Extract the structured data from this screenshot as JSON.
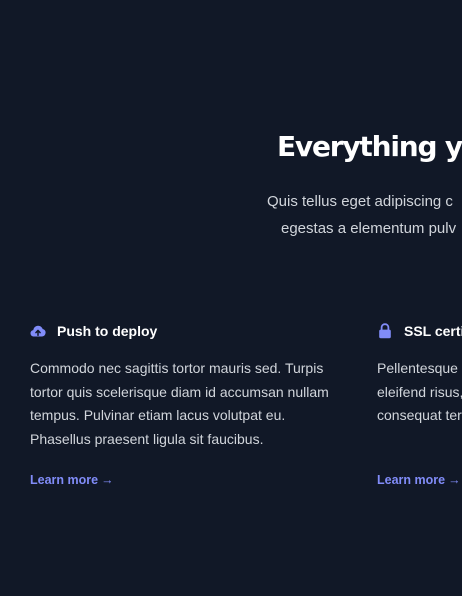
{
  "hero": {
    "title": "Everything you",
    "subtitle_line1": "Quis tellus eget adipiscing c",
    "subtitle_line2": "egestas a elementum pulv"
  },
  "features": [
    {
      "title": "Push to deploy",
      "icon": "cloud-upload-icon",
      "desc_lines": [
        "Commodo nec sagittis tortor mauris sed. Turpis",
        "tortor quis scelerisque diam id accumsan nullam",
        "tempus. Pulvinar etiam lacus volutpat eu.",
        "Phasellus praesent ligula sit faucibus."
      ],
      "link_label": "Learn more",
      "link_arrow": "→"
    },
    {
      "title": "SSL certi",
      "icon": "lock-icon",
      "desc_lines": [
        "Pellentesque s",
        "eleifend risus,",
        "consequat ter"
      ],
      "link_label": "Learn more",
      "link_arrow": "→"
    }
  ],
  "colors": {
    "background": "#111827",
    "accent": "#818cf8",
    "text_muted": "#d1d5db"
  }
}
